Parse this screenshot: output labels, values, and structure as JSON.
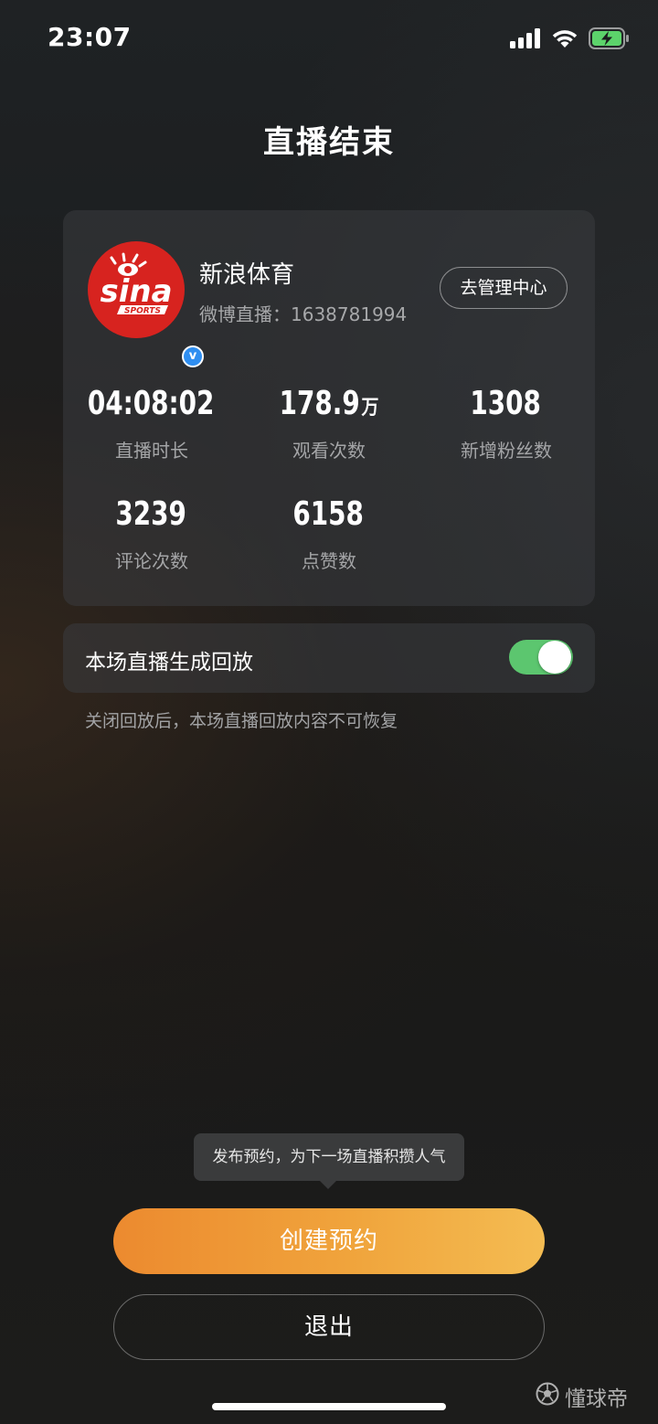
{
  "status_bar": {
    "time": "23:07",
    "icons": [
      "signal-icon",
      "wifi-icon",
      "battery-charging-icon"
    ]
  },
  "page": {
    "title": "直播结束"
  },
  "account": {
    "name": "新浪体育",
    "id_line": "微博直播：1638781994",
    "avatar_logo_text": "sina SPORTS",
    "manage_button": "去管理中心"
  },
  "stats": [
    {
      "value": "04:08:02",
      "unit": "",
      "label": "直播时长"
    },
    {
      "value": "178.9",
      "unit": "万",
      "label": "观看次数"
    },
    {
      "value": "1308",
      "unit": "",
      "label": "新增粉丝数"
    },
    {
      "value": "3239",
      "unit": "",
      "label": "评论次数"
    },
    {
      "value": "6158",
      "unit": "",
      "label": "点赞数"
    }
  ],
  "replay": {
    "label": "本场直播生成回放",
    "enabled": true,
    "note": "关闭回放后，本场直播回放内容不可恢复"
  },
  "tooltip": {
    "text": "发布预约，为下一场直播积攒人气"
  },
  "actions": {
    "create_label": "创建预约",
    "exit_label": "退出"
  },
  "watermark": {
    "text": "懂球帝"
  },
  "colors": {
    "accent_orange": "#ec8a2f",
    "accent_yellow": "#f4bc52",
    "toggle_on": "#5cc66f",
    "avatar_red": "#d7231f",
    "verified_blue": "#2f8ef0",
    "battery_green": "#5cd36b"
  }
}
